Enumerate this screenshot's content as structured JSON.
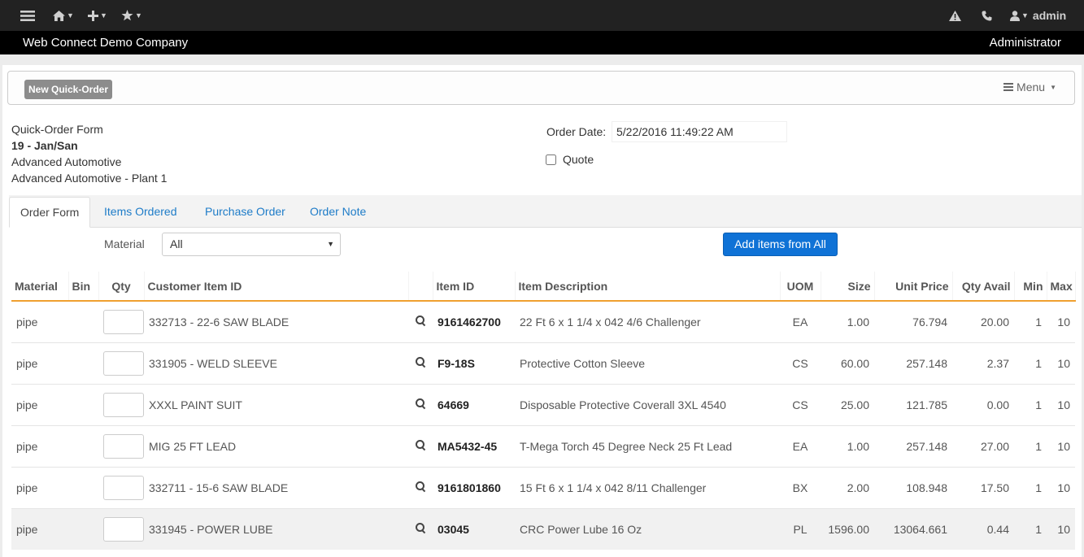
{
  "topbar": {
    "user": "admin"
  },
  "company_bar": {
    "company": "Web Connect Demo Company",
    "role": "Administrator"
  },
  "toolbar": {
    "new_quick_order": "New Quick-Order",
    "menu": "Menu"
  },
  "order_info": {
    "form_title": "Quick-Order Form",
    "order_code": "19 - Jan/San",
    "customer": "Advanced Automotive",
    "ship_to": "Advanced Automotive - Plant 1",
    "order_date_label": "Order Date:",
    "order_date_value": "5/22/2016 11:49:22 AM",
    "quote_label": "Quote"
  },
  "tabs": [
    "Order Form",
    "Items Ordered",
    "Purchase Order",
    "Order Note"
  ],
  "filter": {
    "material_label": "Material",
    "material_value": "All",
    "add_button": "Add items from All"
  },
  "table": {
    "headers": [
      "Material",
      "Bin",
      "Qty",
      "Customer Item ID",
      "",
      "Item ID",
      "Item Description",
      "UOM",
      "Size",
      "Unit Price",
      "Qty Avail",
      "Min",
      "Max"
    ],
    "rows": [
      {
        "material": "pipe",
        "bin": "",
        "customer_item": "332713 - 22-6 SAW BLADE",
        "item_id": "9161462700",
        "description": "22 Ft 6 x 1 1/4 x 042 4/6 Challenger",
        "uom": "EA",
        "size": "1.00",
        "unit_price": "76.794",
        "qty_avail": "20.00",
        "min": "1",
        "max": "10"
      },
      {
        "material": "pipe",
        "bin": "",
        "customer_item": "331905 - WELD SLEEVE",
        "item_id": "F9-18S",
        "description": "Protective Cotton Sleeve",
        "uom": "CS",
        "size": "60.00",
        "unit_price": "257.148",
        "qty_avail": "2.37",
        "min": "1",
        "max": "10"
      },
      {
        "material": "pipe",
        "bin": "",
        "customer_item": "XXXL PAINT SUIT",
        "item_id": "64669",
        "description": "Disposable Protective Coverall 3XL 4540",
        "uom": "CS",
        "size": "25.00",
        "unit_price": "121.785",
        "qty_avail": "0.00",
        "min": "1",
        "max": "10"
      },
      {
        "material": "pipe",
        "bin": "",
        "customer_item": "MIG 25 FT LEAD",
        "item_id": "MA5432-45",
        "description": "T-Mega Torch 45 Degree Neck 25 Ft Lead",
        "uom": "EA",
        "size": "1.00",
        "unit_price": "257.148",
        "qty_avail": "27.00",
        "min": "1",
        "max": "10"
      },
      {
        "material": "pipe",
        "bin": "",
        "customer_item": "332711 - 15-6 SAW BLADE",
        "item_id": "9161801860",
        "description": "15 Ft 6 x 1 1/4 x 042 8/11 Challenger",
        "uom": "BX",
        "size": "2.00",
        "unit_price": "108.948",
        "qty_avail": "17.50",
        "min": "1",
        "max": "10"
      },
      {
        "material": "pipe",
        "bin": "",
        "customer_item": "331945 - POWER LUBE",
        "item_id": "03045",
        "description": "CRC Power Lube 16 Oz",
        "uom": "PL",
        "size": "1596.00",
        "unit_price": "13064.661",
        "qty_avail": "0.44",
        "min": "1",
        "max": "10"
      }
    ]
  }
}
